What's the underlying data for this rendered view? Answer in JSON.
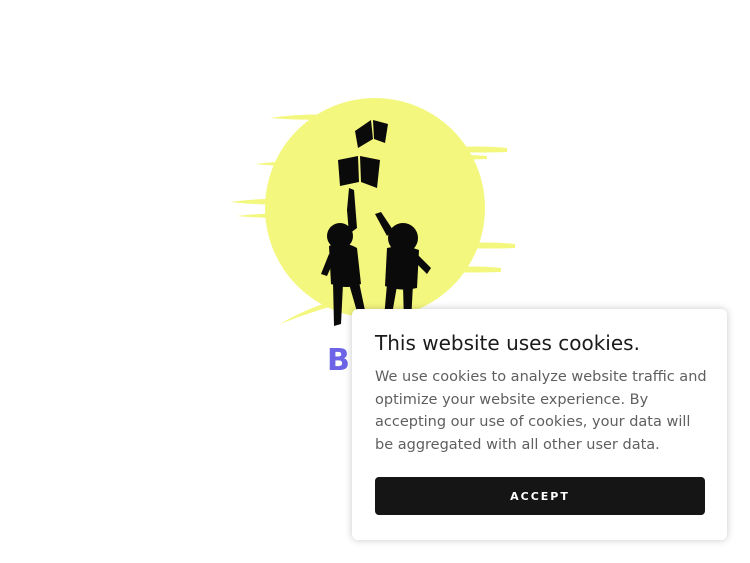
{
  "logo": {
    "icon_name": "children-reaching-for-books-logo",
    "sun_color": "#f4f77e",
    "silhouette_color": "#0a0a0a"
  },
  "brand": {
    "visible_text": "B",
    "color": "#6c63e6"
  },
  "cookie_banner": {
    "title": "This website uses cookies.",
    "body": "We use cookies to analyze website traffic and optimize your website experience. By accepting our use of cookies, your data will be aggregated with all other user data.",
    "accept_label": "ACCEPT",
    "button_color": "#151515"
  }
}
